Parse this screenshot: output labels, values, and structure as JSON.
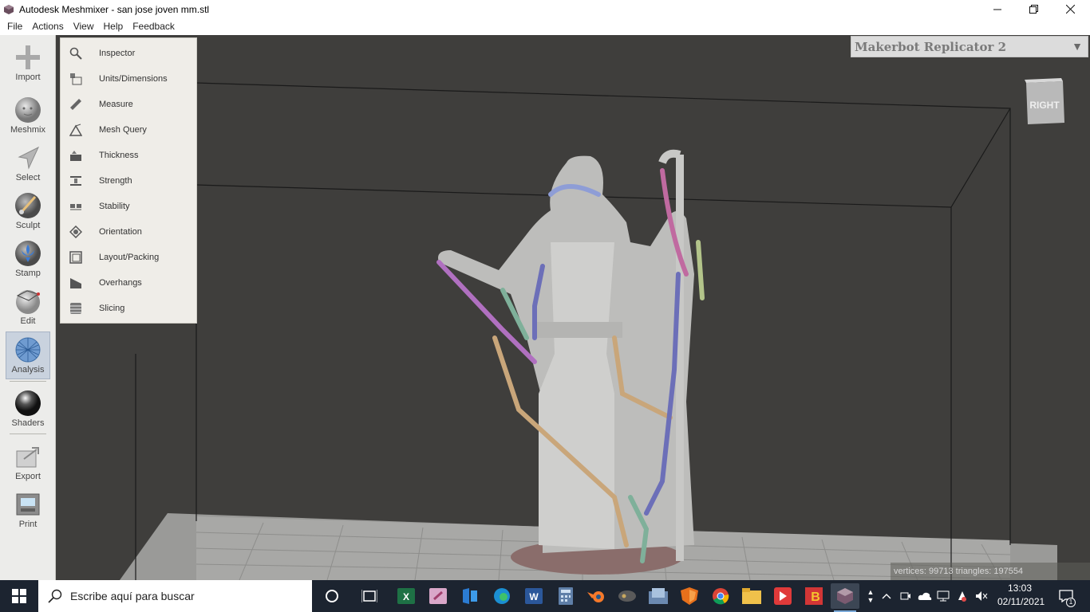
{
  "window": {
    "title": "Autodesk Meshmixer - san jose joven mm.stl",
    "controls": {
      "minimize": "minimize",
      "maximize": "restore",
      "close": "close"
    }
  },
  "menubar": {
    "items": [
      {
        "label": "File"
      },
      {
        "label": "Actions"
      },
      {
        "label": "View"
      },
      {
        "label": "Help"
      },
      {
        "label": "Feedback"
      }
    ]
  },
  "toolbar": {
    "tools": [
      {
        "label": "Import",
        "icon": "plus-icon"
      },
      {
        "label": "Meshmix",
        "icon": "head-sphere-icon"
      },
      {
        "label": "Select",
        "icon": "arrow-cursor-icon"
      },
      {
        "label": "Sculpt",
        "icon": "brush-icon"
      },
      {
        "label": "Stamp",
        "icon": "fleur-de-lis-icon"
      },
      {
        "label": "Edit",
        "icon": "edit-sphere-icon"
      },
      {
        "label": "Analysis",
        "icon": "wire-sphere-icon",
        "active": true
      },
      {
        "label": "Shaders",
        "icon": "shader-sphere-icon"
      },
      {
        "label": "Export",
        "icon": "export-icon"
      },
      {
        "label": "Print",
        "icon": "printer-icon"
      }
    ]
  },
  "analysis_menu": {
    "items": [
      {
        "label": "Inspector",
        "icon": "magnifier-icon"
      },
      {
        "label": "Units/Dimensions",
        "icon": "units-icon"
      },
      {
        "label": "Measure",
        "icon": "ruler-icon"
      },
      {
        "label": "Mesh Query",
        "icon": "mesh-query-icon"
      },
      {
        "label": "Thickness",
        "icon": "thickness-icon"
      },
      {
        "label": "Strength",
        "icon": "strength-icon"
      },
      {
        "label": "Stability",
        "icon": "stability-icon"
      },
      {
        "label": "Orientation",
        "icon": "orientation-icon"
      },
      {
        "label": "Layout/Packing",
        "icon": "layout-packing-icon"
      },
      {
        "label": "Overhangs",
        "icon": "overhangs-icon"
      },
      {
        "label": "Slicing",
        "icon": "slicing-icon"
      }
    ]
  },
  "printer": {
    "name": "Makerbot Replicator 2"
  },
  "view_cube": {
    "face": "RIGHT"
  },
  "stats": {
    "text": "vertices: 99713 triangles: 197554"
  },
  "taskbar": {
    "search_placeholder": "Escribe aquí para buscar",
    "clock_time": "13:03",
    "clock_date": "02/11/2021",
    "notification_count": "1",
    "apps": [
      {
        "name": "cortana-icon"
      },
      {
        "name": "task-view-icon"
      },
      {
        "name": "excel-icon"
      },
      {
        "name": "powerpoint-icon"
      },
      {
        "name": "files-icon"
      },
      {
        "name": "edge-icon"
      },
      {
        "name": "word-icon"
      },
      {
        "name": "calculator-icon"
      },
      {
        "name": "blender-icon"
      },
      {
        "name": "game-icon"
      },
      {
        "name": "network-folder-icon"
      },
      {
        "name": "shield-app-icon"
      },
      {
        "name": "chrome-icon"
      },
      {
        "name": "file-explorer-icon"
      },
      {
        "name": "red-app-icon"
      },
      {
        "name": "b-app-icon"
      },
      {
        "name": "meshmixer-icon"
      }
    ]
  }
}
